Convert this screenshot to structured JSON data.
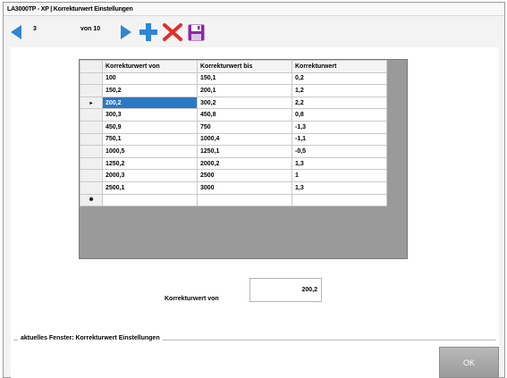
{
  "window": {
    "title": "LA3000TP - XP | Korrekturwert Einstellungen"
  },
  "toolbar": {
    "record_number": "3",
    "record_of": "von 10",
    "icons": [
      "arrow-left-icon",
      "arrow-right-icon",
      "plus-icon",
      "x-icon",
      "floppy-disk-icon"
    ],
    "accent_color": "#2f86d1"
  },
  "grid": {
    "columns": [
      "Korrekturwert von",
      "Korrekturwert bis",
      "Korrekturwert"
    ],
    "selected_row_marker": "▸",
    "new_row_marker": "✱",
    "rows": [
      [
        "100",
        "150,1",
        "0,2"
      ],
      [
        "150,2",
        "200,1",
        "1,2"
      ],
      [
        "200,2",
        "300,2",
        "2,2"
      ],
      [
        "300,3",
        "450,8",
        "0,8"
      ],
      [
        "450,9",
        "750",
        "-1,3"
      ],
      [
        "750,1",
        "1000,4",
        "-1,1"
      ],
      [
        "1000,5",
        "1250,1",
        "-0,5"
      ],
      [
        "1250,2",
        "2000,2",
        "1,3"
      ],
      [
        "2000,3",
        "2500",
        "1"
      ],
      [
        "2500,1",
        "3000",
        "1,3"
      ]
    ],
    "selected_row_index": 2
  },
  "field": {
    "label": "Korrekturwert von",
    "value": "200,2"
  },
  "status": {
    "caption": "aktuelles Fenster: Korrekturwert Einstellungen"
  },
  "ok_label": "OK"
}
